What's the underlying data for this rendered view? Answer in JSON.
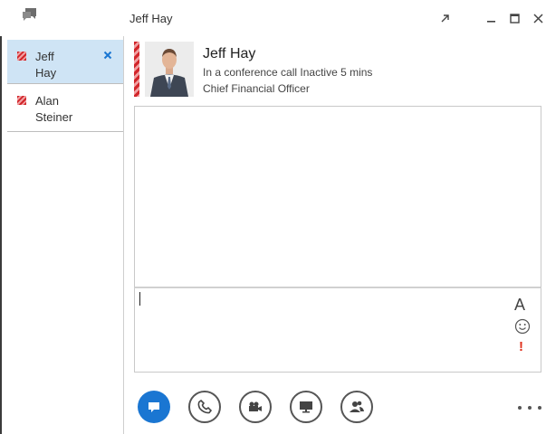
{
  "window": {
    "title": "Jeff Hay",
    "controls": {
      "popout_icon": "popout-icon",
      "minimize_icon": "minimize-icon",
      "maximize_icon": "maximize-icon",
      "close_icon": "close-icon"
    }
  },
  "sidebar": {
    "conversations": [
      {
        "first": "Jeff",
        "last": "Hay",
        "presence": "do-not-disturb",
        "selected": true
      },
      {
        "first": "Alan",
        "last": "Steiner",
        "presence": "do-not-disturb",
        "selected": false
      }
    ]
  },
  "contact": {
    "name": "Jeff Hay",
    "status": "In a conference call Inactive 5 mins",
    "title": "Chief Financial Officer"
  },
  "compose": {
    "value": "",
    "format_label": "A",
    "important_label": "!"
  },
  "toolbar": {
    "buttons": [
      "im-icon",
      "phone-icon",
      "video-icon",
      "present-icon",
      "people-icon"
    ],
    "more_icon": "more-options-icon"
  },
  "colors": {
    "selected_item": "#cfe4f5",
    "presence_busy": "#d2262b",
    "im_button": "#1a76d2",
    "important": "#e0311c"
  }
}
